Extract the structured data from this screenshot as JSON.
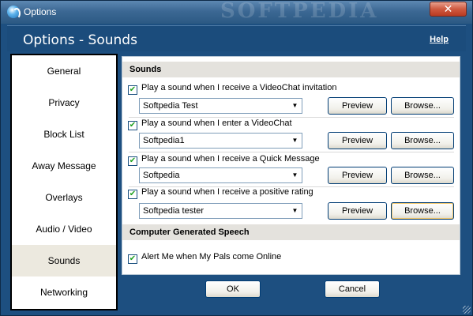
{
  "window": {
    "title": "Options",
    "watermark": "SOFTPEDIA",
    "close_glyph": "✕"
  },
  "header": {
    "title": "Options - Sounds",
    "help_label": "Help"
  },
  "sidebar": {
    "items": [
      {
        "label": "General",
        "active": false
      },
      {
        "label": "Privacy",
        "active": false
      },
      {
        "label": "Block List",
        "active": false
      },
      {
        "label": "Away Message",
        "active": false
      },
      {
        "label": "Overlays",
        "active": false
      },
      {
        "label": "Audio / Video",
        "active": false
      },
      {
        "label": "Sounds",
        "active": true
      },
      {
        "label": "Networking",
        "active": false
      }
    ]
  },
  "sounds": {
    "section_title": "Sounds",
    "rows": [
      {
        "checkbox_label": "Play a sound when I receive a VideoChat invitation",
        "checked": true,
        "selected": "Softpedia Test",
        "preview_label": "Preview",
        "browse_label": "Browse..."
      },
      {
        "checkbox_label": "Play a sound when I enter a VideoChat",
        "checked": true,
        "selected": "Softpedia1",
        "preview_label": "Preview",
        "browse_label": "Browse..."
      },
      {
        "checkbox_label": "Play a sound when I receive a Quick Message",
        "checked": true,
        "selected": "Softpedia",
        "preview_label": "Preview",
        "browse_label": "Browse..."
      },
      {
        "checkbox_label": "Play a sound when I receive a positive rating",
        "checked": true,
        "selected": "Softpedia tester",
        "preview_label": "Preview",
        "browse_label": "Browse..."
      }
    ]
  },
  "speech": {
    "section_title": "Computer Generated Speech",
    "checkbox_label": "Alert Me when My Pals come Online",
    "checked": true
  },
  "footer": {
    "ok_label": "OK",
    "cancel_label": "Cancel"
  },
  "icons": {
    "check": "✔",
    "dropdown": "▼",
    "app": "globe-icon"
  },
  "colors": {
    "frame": "#1d4f80",
    "header": "#1b4c7c",
    "section": "#e4e2dd",
    "active_nav": "#ece9df"
  }
}
